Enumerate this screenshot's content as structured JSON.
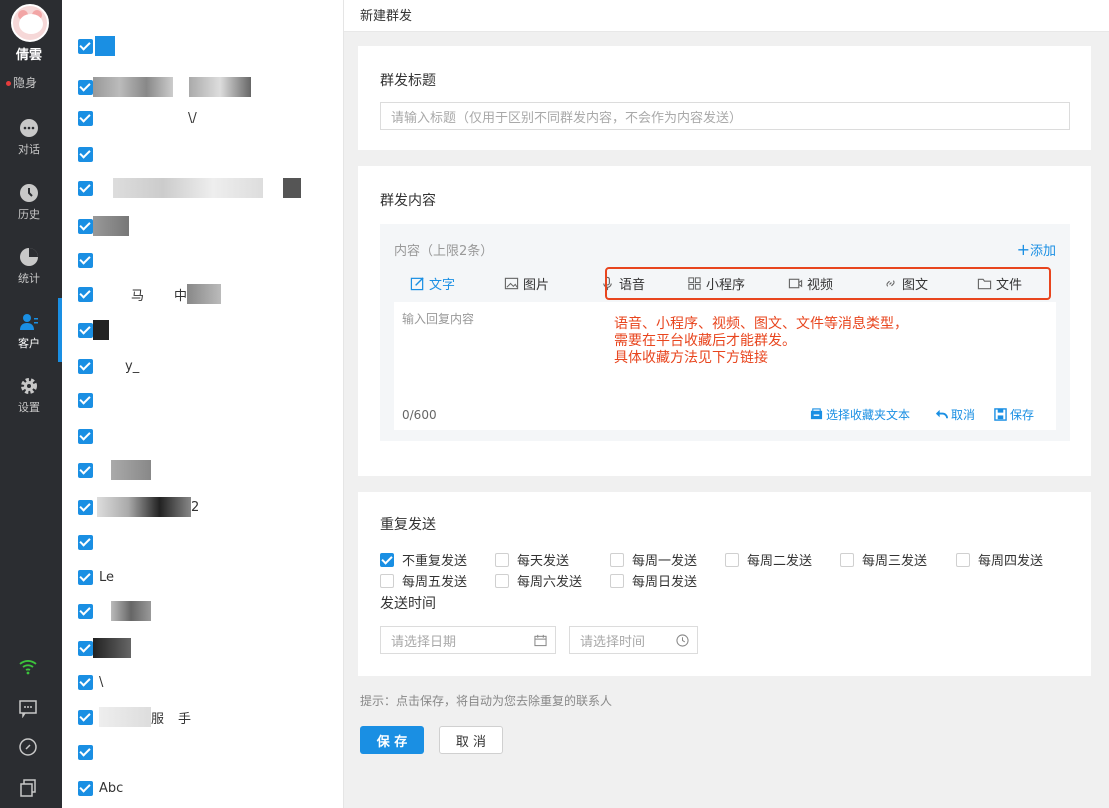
{
  "colors": {
    "accent": "#1a8fe3",
    "highlight": "#e8451e",
    "nav_bg": "#2b2d31"
  },
  "nav": {
    "user_name": "倩雲",
    "status": "隐身",
    "items": [
      {
        "label": "对话",
        "icon": "chat-bubble-icon"
      },
      {
        "label": "历史",
        "icon": "clock-icon"
      },
      {
        "label": "统计",
        "icon": "pie-chart-icon"
      },
      {
        "label": "客户",
        "icon": "customer-icon"
      },
      {
        "label": "设置",
        "icon": "gear-icon"
      }
    ],
    "active": "客户",
    "bottom_icons": [
      "wifi-icon",
      "message-square-icon",
      "link-icon",
      "copy-icon"
    ]
  },
  "contacts": {
    "visible_names": [
      "\\/",
      "y_",
      "马",
      "中",
      "2",
      "Le",
      "\\",
      "服",
      "手",
      "Abc"
    ]
  },
  "page": {
    "title": "新建群发"
  },
  "broadcast_title": {
    "heading": "群发标题",
    "placeholder": "请输入标题（仅用于区别不同群发内容，不会作为内容发送）"
  },
  "content": {
    "heading": "群发内容",
    "limit_label": "内容（上限2条）",
    "add_label": "添加",
    "tabs": [
      "文字",
      "图片",
      "语音",
      "小程序",
      "视频",
      "图文",
      "文件"
    ],
    "active_tab": "文字",
    "reply_placeholder": "输入回复内容",
    "annotation_line1": "语音、小程序、视频、图文、文件等消息类型，",
    "annotation_line2": "需要在平台收藏后才能群发。",
    "annotation_line3": "具体收藏方法见下方链接",
    "counter": "0/600",
    "action_select": "选择收藏夹文本",
    "action_cancel": "取消",
    "action_save": "保存"
  },
  "repeat": {
    "heading": "重复发送",
    "options": [
      "不重复发送",
      "每天发送",
      "每周一发送",
      "每周二发送",
      "每周三发送",
      "每周四发送",
      "每周五发送",
      "每周六发送",
      "每周日发送"
    ],
    "selected": "不重复发送",
    "time_heading": "发送时间",
    "date_placeholder": "请选择日期",
    "time_placeholder": "请选择时间"
  },
  "footer": {
    "tip": "提示：点击保存，将自动为您去除重复的联系人",
    "save_label": "保 存",
    "cancel_label": "取 消"
  }
}
